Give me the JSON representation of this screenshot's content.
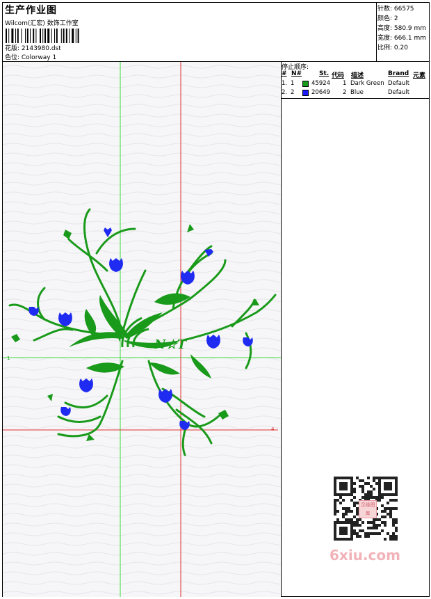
{
  "header": {
    "title": "生产作业图",
    "subtitle": "Wilcom(汇宏) 数饰工作室",
    "design_label": "花版: 2143980.dst",
    "colorway_label": "色位: Colorway 1"
  },
  "stats": {
    "stitches": "针数: 66575",
    "colors": "颜色: 2",
    "height": "高度: 580.9 mm",
    "width": "宽度: 666.1 mm",
    "scale": "比例: 0.20"
  },
  "stop_sequence": {
    "label": "停止顺序:",
    "headers": [
      "#",
      "N#",
      "St.",
      "代码",
      "描述",
      "Brand",
      "元素"
    ],
    "rows": [
      {
        "index": "1.",
        "needle": "1",
        "stitches": "45924",
        "code": "1",
        "description": "Dark Green",
        "brand": "Default",
        "color": "#1a9a1a"
      },
      {
        "index": "2.",
        "needle": "2",
        "stitches": "20649",
        "code": "2",
        "description": "Blue",
        "brand": "Default",
        "color": "#1a1aff"
      }
    ]
  },
  "design": {
    "monogram": "N☆T",
    "green": "#1a9a1a",
    "blue": "#1f2bf0",
    "guide_green": "#3ddc3d",
    "guide_red": "#e03030"
  },
  "watermark": {
    "text": "6xiu.com",
    "stamp": "汉缘图库"
  }
}
